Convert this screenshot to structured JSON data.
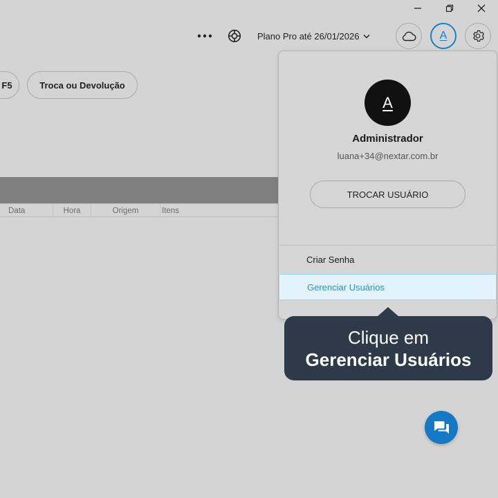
{
  "window_controls": {
    "minimize_icon": "minimize-icon",
    "restore_icon": "restore-icon",
    "close_icon": "close-icon"
  },
  "topbar": {
    "more_icon": "more-horizontal-icon",
    "help_icon": "lifebuoy-icon",
    "plan_label": "Plano Pro até 26/01/2026",
    "plan_chevron_icon": "chevron-down-icon",
    "cloud_icon": "cloud-icon",
    "user_initial": "A",
    "settings_icon": "gear-icon"
  },
  "chips": {
    "partial_label": "F5",
    "exchange_label": "Troca ou Devolução"
  },
  "table": {
    "columns": [
      "Data",
      "Hora",
      "Origem",
      "Itens"
    ]
  },
  "user_menu": {
    "avatar_initial": "A",
    "name": "Administrador",
    "email": "luana+34@nextar.com.br",
    "switch_user_label": "TROCAR USUÁRIO",
    "items": [
      {
        "label": "Criar Senha",
        "highlighted": false
      },
      {
        "label": "Gerenciar Usuários",
        "highlighted": true
      }
    ]
  },
  "tooltip": {
    "line1": "Clique em",
    "line2": "Gerenciar Usuários"
  },
  "chat": {
    "icon": "chat-icon"
  },
  "colors": {
    "background": "#d4d4d4",
    "accent_blue": "#1682c8",
    "highlight_bg": "#e3f3fc",
    "highlight_text": "#1d97cf",
    "tooltip_bg": "#2d3a49",
    "fab_bg": "#1478c4",
    "table_header_bar": "#808080"
  }
}
